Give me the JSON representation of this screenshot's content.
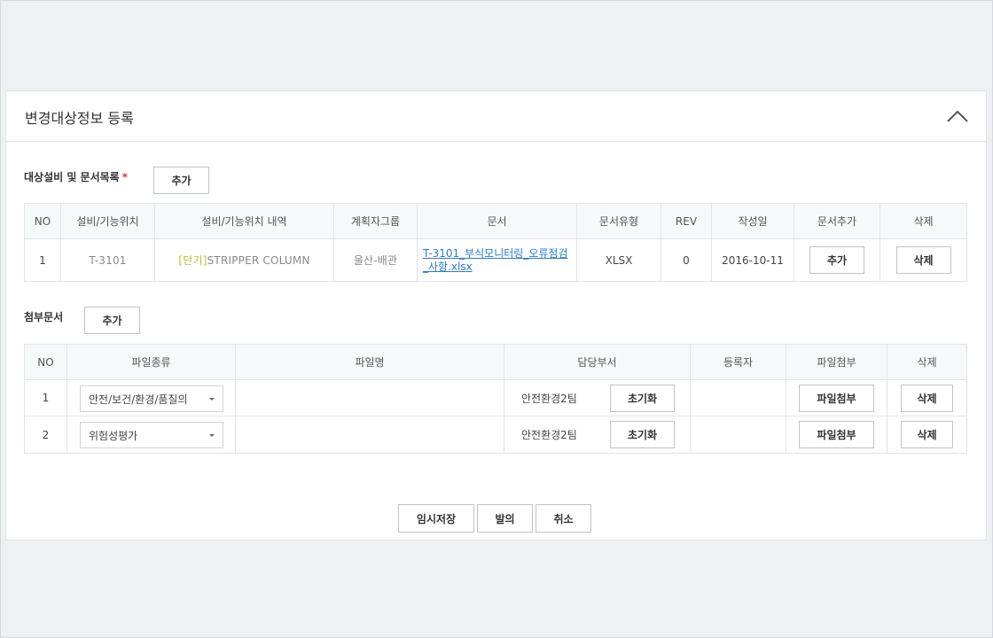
{
  "panel": {
    "title": "변경대상정보 등록"
  },
  "equipment": {
    "label": "대상설비 및 문서목록",
    "required_mark": "*",
    "add_label": "추가",
    "columns": [
      "NO",
      "설비/기능위치",
      "설비/기능위치 내역",
      "계획자그룹",
      "문서",
      "문서유형",
      "REV",
      "작성일",
      "문서추가",
      "삭제"
    ],
    "rows": [
      {
        "no": "1",
        "location": "T-3101",
        "desc_tag": "[단기]",
        "desc_text": "STRIPPER COLUMN",
        "planner": "울산-배관",
        "doc": "T-3101_부식모니터링_오류점검_사항.xlsx",
        "doc_type": "XLSX",
        "rev": "0",
        "date": "2016-10-11",
        "add_doc_label": "추가",
        "delete_label": "삭제"
      }
    ]
  },
  "attachments": {
    "label": "첨부문서",
    "add_label": "추가",
    "columns": [
      "NO",
      "파일종류",
      "파일명",
      "담당부서",
      "등록자",
      "파일첨부",
      "삭제"
    ],
    "rows": [
      {
        "no": "1",
        "file_type": "안전/보건/환경/품질의",
        "file_name": "",
        "dept": "안전환경2팀",
        "reset_label": "초기화",
        "registrant": "",
        "attach_label": "파일첨부",
        "delete_label": "삭제"
      },
      {
        "no": "2",
        "file_type": "위험성평가",
        "file_name": "",
        "dept": "안전환경2팀",
        "reset_label": "초기화",
        "registrant": "",
        "attach_label": "파일첨부",
        "delete_label": "삭제"
      }
    ]
  },
  "footer": {
    "temp_save_label": "임시저장",
    "submit_label": "발의",
    "cancel_label": "취소"
  },
  "icons": {
    "collapse": "chevron-up-icon",
    "select_caret": "caret-down-icon"
  },
  "colors": {
    "link": "#2a7bd3",
    "required": "#e03a3a",
    "background": "#eef0f1"
  }
}
